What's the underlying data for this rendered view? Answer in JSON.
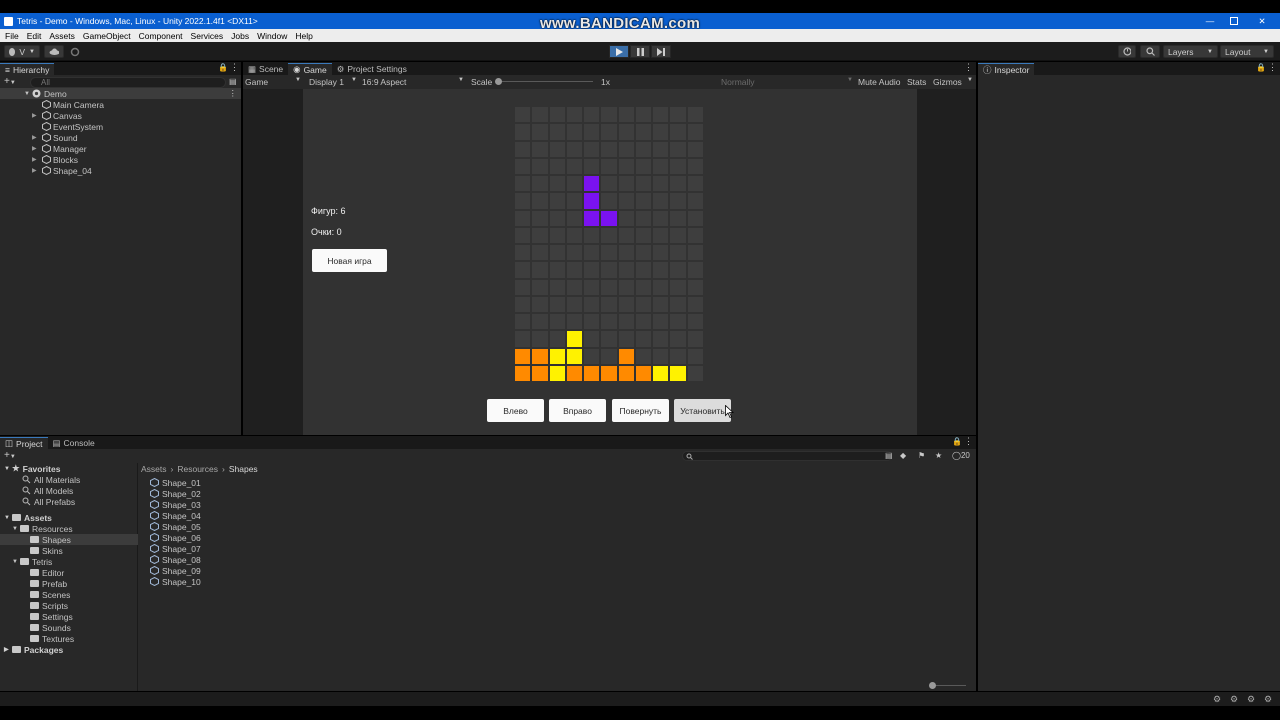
{
  "window": {
    "title": "Tetris - Demo - Windows, Mac, Linux - Unity 2022.1.4f1 <DX11>",
    "watermark": "www.BANDICAM.com"
  },
  "menu": [
    "File",
    "Edit",
    "Assets",
    "GameObject",
    "Component",
    "Services",
    "Jobs",
    "Window",
    "Help"
  ],
  "toolbar": {
    "account_label": "V",
    "layers_label": "Layers",
    "layout_label": "Layout"
  },
  "hierarchy": {
    "tab": "Hierarchy",
    "search_placeholder": "All",
    "scene": "Demo",
    "items": [
      "Main Camera",
      "Canvas",
      "EventSystem",
      "Sound",
      "Manager",
      "Blocks",
      "Shape_04"
    ]
  },
  "game_panel": {
    "tabs": [
      "Scene",
      "Game",
      "Project Settings"
    ],
    "game_label": "Game",
    "display_label": "Display 1",
    "aspect_label": "16:9 Aspect",
    "scale_label": "Scale",
    "scale_value": "1x",
    "vsync_label": "Normally",
    "mute_label": "Mute Audio",
    "stats_label": "Stats",
    "gizmos_label": "Gizmos"
  },
  "game": {
    "figures_label": "Фигур: 6",
    "score_label": "Очки: 0",
    "new_game_button": "Новая игра",
    "left_button": "Влево",
    "right_button": "Вправо",
    "rotate_button": "Повернуть",
    "place_button": "Установить",
    "grid": {
      "columns": 11,
      "rows": 16,
      "empty_color": "#3e3e3e",
      "colors": {
        "P": "#7a12f0",
        "O": "#ff8a00",
        "Y": "#fff200"
      },
      "cells": [
        "...........",
        "...........",
        "...........",
        "...........",
        "....P......",
        "....P......",
        "....PP.....",
        "...........",
        "...........",
        "...........",
        "...........",
        "...........",
        "...........",
        "...Y.......",
        "OOYY..O....",
        "OOYOOOOOYY."
      ]
    }
  },
  "inspector": {
    "tab": "Inspector"
  },
  "project": {
    "tabs": [
      "Project",
      "Console"
    ],
    "breadcrumb": [
      "Assets",
      "Resources",
      "Shapes"
    ],
    "favorites_label": "Favorites",
    "favorites": [
      "All Materials",
      "All Models",
      "All Prefabs"
    ],
    "assets_label": "Assets",
    "tree": [
      {
        "label": "Resources",
        "depth": 1
      },
      {
        "label": "Shapes",
        "depth": 2
      },
      {
        "label": "Skins",
        "depth": 2
      },
      {
        "label": "Tetris",
        "depth": 1
      },
      {
        "label": "Editor",
        "depth": 2
      },
      {
        "label": "Prefab",
        "depth": 2
      },
      {
        "label": "Scenes",
        "depth": 2
      },
      {
        "label": "Scripts",
        "depth": 2
      },
      {
        "label": "Settings",
        "depth": 2
      },
      {
        "label": "Sounds",
        "depth": 2
      },
      {
        "label": "Textures",
        "depth": 2
      }
    ],
    "packages_label": "Packages",
    "files": [
      "Shape_01",
      "Shape_02",
      "Shape_03",
      "Shape_04",
      "Shape_05",
      "Shape_06",
      "Shape_07",
      "Shape_08",
      "Shape_09",
      "Shape_10"
    ],
    "hidden_count": "20"
  }
}
